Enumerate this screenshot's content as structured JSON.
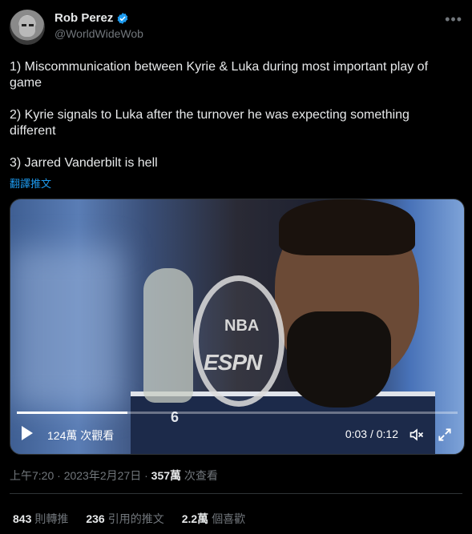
{
  "author": {
    "display_name": "Rob Perez",
    "handle": "@WorldWideWob"
  },
  "tweet": {
    "lines": [
      "1) Miscommunication between Kyrie & Luka during most important play of game",
      "2) Kyrie signals to Luka after the turnover he was expecting something different",
      "3) Jarred Vanderbilt is hell"
    ],
    "translate_label": "翻譯推文"
  },
  "video": {
    "overlay_nba": "NBA",
    "overlay_espn": "ESPN",
    "jersey_number": "6",
    "views": "124萬 次觀看",
    "time": "0:03 / 0:12",
    "progress": 0.25
  },
  "meta": {
    "time": "上午7:20",
    "date": "2023年2月27日",
    "views_count": "357萬",
    "views_label": "次查看"
  },
  "stats": {
    "retweets_count": "843",
    "retweets_label": "則轉推",
    "quotes_count": "236",
    "quotes_label": "引用的推文",
    "likes_count": "2.2萬",
    "likes_label": "個喜歡"
  },
  "colors": {
    "background": "#000000",
    "accent": "#1d9bf0",
    "muted": "#71767b"
  },
  "icons": [
    "avatar",
    "verified-badge-icon",
    "more-icon",
    "play-icon",
    "volume-icon",
    "fullscreen-icon"
  ]
}
